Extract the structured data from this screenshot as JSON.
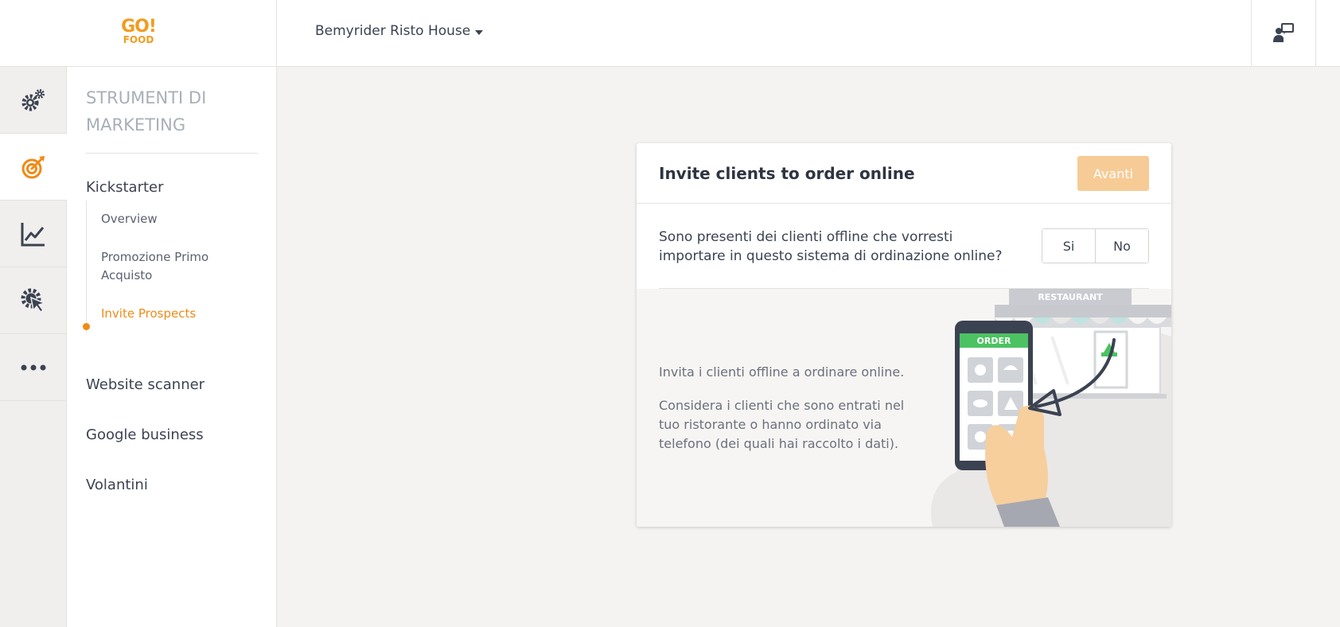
{
  "header": {
    "logo_top": "GO!",
    "logo_bottom": "FOOD",
    "restaurant_name": "Bemyrider Risto House"
  },
  "rail": {
    "items": [
      {
        "icon": "gears-icon"
      },
      {
        "icon": "target-icon",
        "active": true
      },
      {
        "icon": "chart-icon"
      },
      {
        "icon": "cursor-gear-icon"
      },
      {
        "icon": "more-icon"
      }
    ]
  },
  "sidebar": {
    "title": "STRUMENTI DI MARKETING",
    "kickstarter": "Kickstarter",
    "sub_items": [
      "Overview",
      "Promozione Primo Acquisto",
      "Invite Prospects"
    ],
    "website_scanner": "Website scanner",
    "google_business": "Google business",
    "volantini": "Volantini"
  },
  "card": {
    "title": "Invite clients to order online",
    "next_label": "Avanti",
    "question": "Sono presenti dei clienti offline che vorresti importare in questo sistema di ordinazione online?",
    "yes_label": "Si",
    "no_label": "No",
    "desc1": "Invita i clienti offline a ordinare online.",
    "desc2": "Considera i clienti che sono entrati nel tuo ristorante o hanno ordinato via telefono (dei quali hai raccolto i dati).",
    "illustration": {
      "sign_text": "RESTAURANT",
      "phone_header": "ORDER"
    }
  },
  "colors": {
    "accent": "#f08a17",
    "button_disabled": "#f7cb96",
    "phone_green": "#4cc262"
  }
}
